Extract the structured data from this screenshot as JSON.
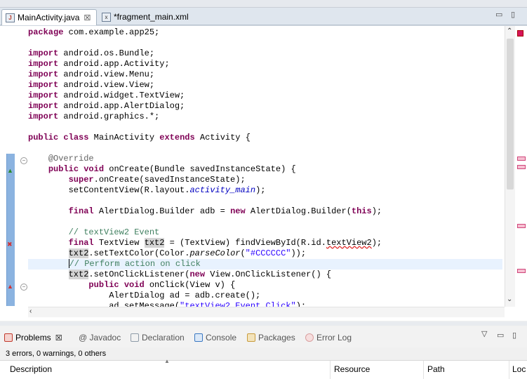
{
  "tabs": [
    {
      "label": "MainActivity.java",
      "close": "☒",
      "icon": "J"
    },
    {
      "label": "*fragment_main.xml",
      "icon": "x"
    }
  ],
  "window_controls": {
    "minimize": "▭",
    "maximize": "▯"
  },
  "code_lines": [
    [
      {
        "t": "package",
        "c": "kw"
      },
      {
        "t": " com.example.app25;"
      }
    ],
    [],
    [
      {
        "t": "import",
        "c": "kw"
      },
      {
        "t": " android.os.Bundle;"
      }
    ],
    [
      {
        "t": "import",
        "c": "kw"
      },
      {
        "t": " android.app.Activity;"
      }
    ],
    [
      {
        "t": "import",
        "c": "kw"
      },
      {
        "t": " android.view.Menu;"
      }
    ],
    [
      {
        "t": "import",
        "c": "kw"
      },
      {
        "t": " android.view.View;"
      }
    ],
    [
      {
        "t": "import",
        "c": "kw"
      },
      {
        "t": " android.widget.TextView;"
      }
    ],
    [
      {
        "t": "import",
        "c": "kw"
      },
      {
        "t": " android.app.AlertDialog;"
      }
    ],
    [
      {
        "t": "import",
        "c": "kw"
      },
      {
        "t": " android.graphics.*;"
      }
    ],
    [],
    [
      {
        "t": "public",
        "c": "kw"
      },
      {
        "t": " "
      },
      {
        "t": "class",
        "c": "kw"
      },
      {
        "t": " MainActivity "
      },
      {
        "t": "extends",
        "c": "kw"
      },
      {
        "t": " Activity {"
      }
    ],
    [],
    [
      {
        "t": "    "
      },
      {
        "t": "@Override",
        "c": "ann"
      }
    ],
    [
      {
        "t": "    "
      },
      {
        "t": "public",
        "c": "kw"
      },
      {
        "t": " "
      },
      {
        "t": "void",
        "c": "kw"
      },
      {
        "t": " onCreate(Bundle savedInstanceState) {"
      }
    ],
    [
      {
        "t": "        "
      },
      {
        "t": "super",
        "c": "kw"
      },
      {
        "t": ".onCreate(savedInstanceState);"
      }
    ],
    [
      {
        "t": "        setContentView(R.layout."
      },
      {
        "t": "activity_main",
        "c": "it"
      },
      {
        "t": ");"
      }
    ],
    [],
    [
      {
        "t": "        "
      },
      {
        "t": "final",
        "c": "kw"
      },
      {
        "t": " AlertDialog.Builder adb = "
      },
      {
        "t": "new",
        "c": "kw"
      },
      {
        "t": " AlertDialog.Builder("
      },
      {
        "t": "this",
        "c": "kw"
      },
      {
        "t": ");"
      }
    ],
    [],
    [
      {
        "t": "        "
      },
      {
        "t": "// textView2 Event",
        "c": "cm"
      }
    ],
    [
      {
        "t": "        "
      },
      {
        "t": "final",
        "c": "kw"
      },
      {
        "t": " TextView "
      },
      {
        "t": "txt2",
        "c": "hl"
      },
      {
        "t": " = (TextView) findViewById(R.id."
      },
      {
        "t": "textView2",
        "c": "err"
      },
      {
        "t": ");"
      }
    ],
    [
      {
        "t": "        "
      },
      {
        "t": "txt2",
        "c": "hl"
      },
      {
        "t": ".setTextColor(Color."
      },
      {
        "t": "parseColor",
        "c": "itplain"
      },
      {
        "t": "("
      },
      {
        "t": "\"#CCCCCC\"",
        "c": "str"
      },
      {
        "t": "));"
      }
    ],
    [
      {
        "t": "        "
      },
      {
        "t": "// Perform action on click",
        "c": "cm"
      }
    ],
    [
      {
        "t": "        "
      },
      {
        "t": "txt2",
        "c": "hl"
      },
      {
        "t": ".setOnClickListener("
      },
      {
        "t": "new",
        "c": "kw"
      },
      {
        "t": " View.OnClickListener() {"
      }
    ],
    [
      {
        "t": "            "
      },
      {
        "t": "public",
        "c": "kw"
      },
      {
        "t": " "
      },
      {
        "t": "void",
        "c": "kw"
      },
      {
        "t": " onClick(View v) {"
      }
    ],
    [
      {
        "t": "                AlertDialog ad = adb.create();"
      }
    ],
    [
      {
        "t": "                ad.setMessage("
      },
      {
        "t": "\"textView2 Event Click\"",
        "c": "str"
      },
      {
        "t": ");"
      }
    ]
  ],
  "current_line_index": 22,
  "panel_tabs": [
    {
      "label": "Problems",
      "close": "☒",
      "color": "#c0392b"
    },
    {
      "label": "@ Javadoc",
      "color": ""
    },
    {
      "label": "Declaration",
      "color": "#8e9ba8"
    },
    {
      "label": "Console",
      "color": "#3a78c2"
    },
    {
      "label": "Packages",
      "color": "#c89b3c"
    },
    {
      "label": "Error Log",
      "color": "#d9a0a0"
    }
  ],
  "panel_controls": {
    "view_menu": "▽",
    "minimize": "▭",
    "maximize": "▯"
  },
  "problems_summary": "3 errors, 0 warnings, 0 others",
  "problems_columns": [
    "Description",
    "Resource",
    "Path",
    "Loc"
  ],
  "colors": {
    "keyword": "#7f0055",
    "comment": "#3f7f5f",
    "string": "#2a00ff",
    "field": "#0000c0"
  }
}
